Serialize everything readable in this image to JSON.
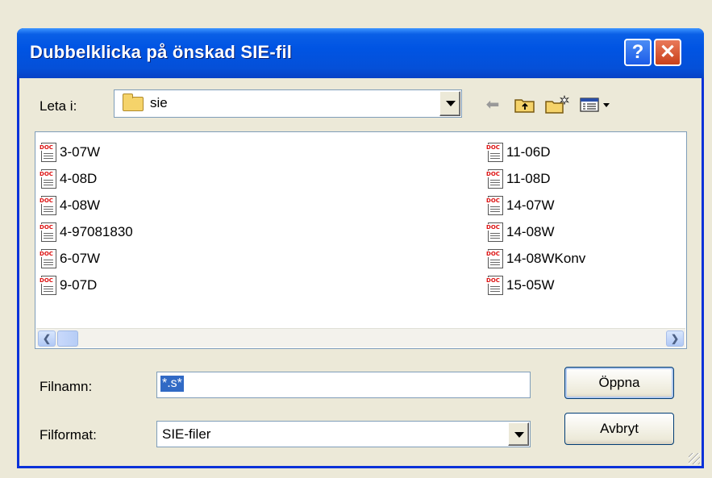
{
  "window": {
    "title": "Dubbelklicka på önskad SIE-fil",
    "help_label": "?",
    "close_label": "✕"
  },
  "lookin": {
    "label": "Leta i:",
    "value": "sie"
  },
  "files": {
    "left": [
      "3-07W",
      "4-08D",
      "4-08W",
      "4-97081830",
      "6-07W",
      "9-07D"
    ],
    "right": [
      "11-06D",
      "11-08D",
      "14-07W",
      "14-08W",
      "14-08WKonv",
      "15-05W"
    ]
  },
  "filename": {
    "label": "Filnamn:",
    "value": "*.s*"
  },
  "filetype": {
    "label": "Filformat:",
    "value": "SIE-filer"
  },
  "buttons": {
    "open": "Öppna",
    "cancel": "Avbryt"
  },
  "icons": {
    "file_tag": "DOC"
  },
  "colors": {
    "titlebar": "#0054e3",
    "selection": "#316ac5",
    "face": "#ece9d8"
  }
}
